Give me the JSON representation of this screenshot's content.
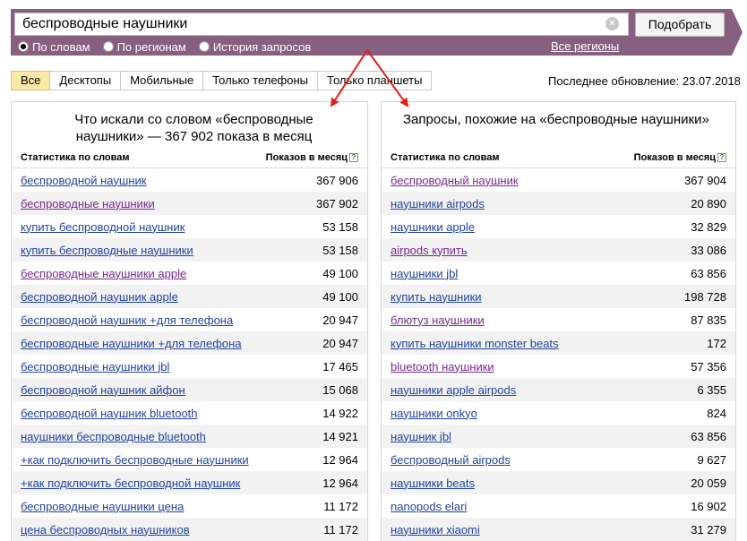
{
  "search": {
    "query": "беспроводные наушники",
    "submit_label": "Подобрать",
    "clear_glyph": "×",
    "modes": [
      {
        "label": "По словам",
        "checked": true
      },
      {
        "label": "По регионам",
        "checked": false
      },
      {
        "label": "История запросов",
        "checked": false
      }
    ],
    "regions_link": "Все регионы"
  },
  "tabs": [
    {
      "label": "Все",
      "active": true
    },
    {
      "label": "Десктопы",
      "active": false
    },
    {
      "label": "Мобильные",
      "active": false
    },
    {
      "label": "Только телефоны",
      "active": false
    },
    {
      "label": "Только планшеты",
      "active": false
    }
  ],
  "last_update": "Последнее обновление: 23.07.2018",
  "left_panel": {
    "title": "Что искали со словом «беспроводные наушники» — 367 902 показа в месяц",
    "col_words": "Статистика по словам",
    "col_shows": "Показов в месяц",
    "help_glyph": "?",
    "rows": [
      {
        "phrase": "беспроводной наушник",
        "count": "367 906",
        "visited": false
      },
      {
        "phrase": "беспроводные наушники",
        "count": "367 902",
        "visited": true
      },
      {
        "phrase": "купить беспроводной наушник",
        "count": "53 158",
        "visited": false
      },
      {
        "phrase": "купить беспроводные наушники",
        "count": "53 158",
        "visited": false
      },
      {
        "phrase": "беспроводные наушники apple",
        "count": "49 100",
        "visited": true
      },
      {
        "phrase": "беспроводной наушник apple",
        "count": "49 100",
        "visited": false
      },
      {
        "phrase": "беспроводной наушник +для телефона",
        "count": "20 947",
        "visited": false
      },
      {
        "phrase": "беспроводные наушники +для телефона",
        "count": "20 947",
        "visited": false
      },
      {
        "phrase": "беспроводные наушники jbl",
        "count": "17 465",
        "visited": false
      },
      {
        "phrase": "беспроводной наушник айфон",
        "count": "15 068",
        "visited": false
      },
      {
        "phrase": "беспроводной наушник bluetooth",
        "count": "14 922",
        "visited": false
      },
      {
        "phrase": "наушники беспроводные bluetooth",
        "count": "14 921",
        "visited": false
      },
      {
        "phrase": "+как подключить беспроводные наушники",
        "count": "12 964",
        "visited": false
      },
      {
        "phrase": "+как подключить беспроводной наушник",
        "count": "12 964",
        "visited": false
      },
      {
        "phrase": "беспроводные наушники цена",
        "count": "11 172",
        "visited": false
      },
      {
        "phrase": "цена беспроводных наушников",
        "count": "11 172",
        "visited": false
      }
    ]
  },
  "right_panel": {
    "title": "Запросы, похожие на «беспроводные наушники»",
    "col_words": "Статистика по словам",
    "col_shows": "Показов в месяц",
    "help_glyph": "?",
    "rows": [
      {
        "phrase": "беспроводный наушник",
        "count": "367 904",
        "visited": true
      },
      {
        "phrase": "наушники airpods",
        "count": "20 890",
        "visited": false
      },
      {
        "phrase": "наушники apple",
        "count": "32 829",
        "visited": false
      },
      {
        "phrase": "airpods купить",
        "count": "33 086",
        "visited": true
      },
      {
        "phrase": "наушники jbl",
        "count": "63 856",
        "visited": false
      },
      {
        "phrase": "купить наушники",
        "count": "198 728",
        "visited": false
      },
      {
        "phrase": "блютуз наушники",
        "count": "87 835",
        "visited": true
      },
      {
        "phrase": "купить наушники monster beats",
        "count": "172",
        "visited": false
      },
      {
        "phrase": "bluetooth наушники",
        "count": "57 356",
        "visited": true
      },
      {
        "phrase": "наушники apple airpods",
        "count": "6 355",
        "visited": false
      },
      {
        "phrase": "наушники onkyo",
        "count": "824",
        "visited": false
      },
      {
        "phrase": "наушник jbl",
        "count": "63 856",
        "visited": false
      },
      {
        "phrase": "беспроводный airpods",
        "count": "9 627",
        "visited": false
      },
      {
        "phrase": "наушники beats",
        "count": "20 059",
        "visited": false
      },
      {
        "phrase": "nanopods elari",
        "count": "16 902",
        "visited": false
      },
      {
        "phrase": "наушники xiaomi",
        "count": "31 279",
        "visited": false
      }
    ]
  },
  "colors": {
    "header_band": "#88607f",
    "link": "#2243a0",
    "link_visited": "#77298f",
    "active_tab": "#fde9a6",
    "arrow": "#e02020"
  }
}
